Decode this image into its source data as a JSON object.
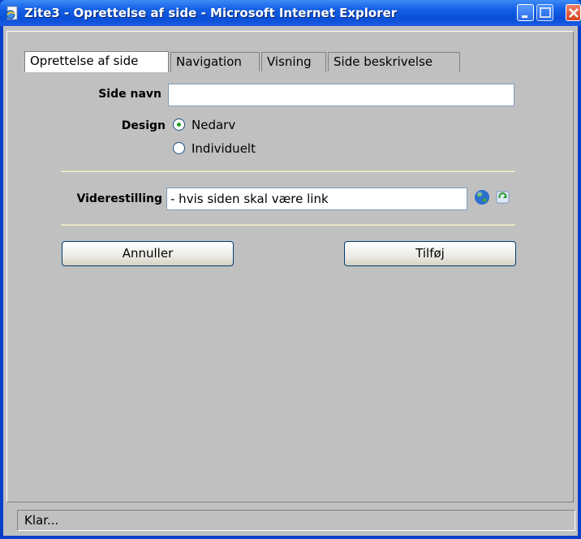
{
  "window": {
    "title": "Zite3 - Oprettelse af side - Microsoft Internet Explorer",
    "icons": [
      "ie-page-icon",
      "minimize-icon",
      "maximize-icon",
      "close-icon"
    ]
  },
  "tabs": [
    {
      "label": "Oprettelse af side",
      "active": true
    },
    {
      "label": "Navigation",
      "active": false
    },
    {
      "label": "Visning",
      "active": false
    },
    {
      "label": "Side beskrivelse",
      "active": false
    }
  ],
  "form": {
    "side_navn_label": "Side navn",
    "side_navn_value": "",
    "design_label": "Design",
    "design_options": [
      {
        "label": "Nedarv",
        "checked": true
      },
      {
        "label": "Individuelt",
        "checked": false
      }
    ],
    "viderestilling_label": "Viderestilling",
    "viderestilling_value": "- hvis siden skal være link",
    "link_icons": [
      "globe-icon",
      "refresh-page-icon"
    ]
  },
  "buttons": {
    "cancel_label": "Annuller",
    "add_label": "Tilføj"
  },
  "status": {
    "text": "Klar..."
  },
  "colors": {
    "titlebar": "#0a4fd8",
    "dialog_background": "#c0c0c0",
    "radio_checked": "#21a121"
  }
}
